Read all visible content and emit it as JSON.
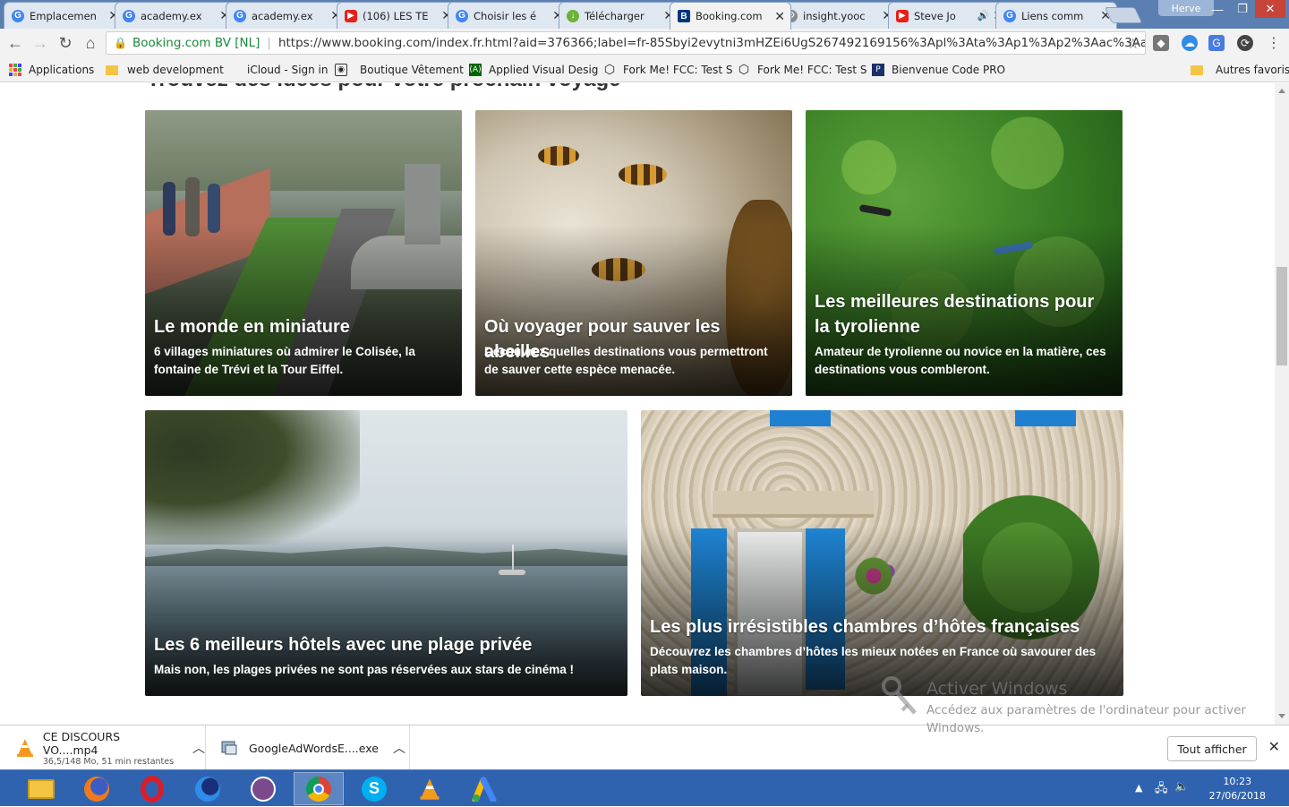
{
  "browser": {
    "tabs": [
      {
        "title": "Emplacemen",
        "icon": "google-icon",
        "color": "#4285f4",
        "letter": "G"
      },
      {
        "title": "academy.ex",
        "icon": "google-icon",
        "color": "#4285f4",
        "letter": "G"
      },
      {
        "title": "academy.ex",
        "icon": "google-icon",
        "color": "#4285f4",
        "letter": "G"
      },
      {
        "title": "(106) LES TE",
        "icon": "youtube-icon",
        "color": "#e62117",
        "letter": "▶"
      },
      {
        "title": "Choisir les é",
        "icon": "google-icon",
        "color": "#4285f4",
        "letter": "G"
      },
      {
        "title": "Télécharger",
        "icon": "download-icon",
        "color": "#6bb23b",
        "letter": "↓"
      },
      {
        "title": "Booking.com",
        "icon": "booking-icon",
        "color": "#003580",
        "letter": "B"
      },
      {
        "title": "insight.yooc",
        "icon": "gear-icon",
        "color": "#888888",
        "letter": "⚙"
      },
      {
        "title": "Steve Jo",
        "icon": "youtube-icon",
        "color": "#e62117",
        "letter": "▶"
      },
      {
        "title": "Liens comm",
        "icon": "google-icon",
        "color": "#4285f4",
        "letter": "G"
      }
    ],
    "audio_icon": "🔊",
    "user": "Herve",
    "secure_label": "Booking.com BV [NL]",
    "url": "https://www.booking.com/index.fr.html?aid=376366;label=fr-85Sbyi2evytni3mHZEi6UgS267492169156%3Apl%3Ata%3Ap1%3Ap2%3Aac%3Aap1t1%3A...",
    "bookmarks": [
      {
        "label": "Applications",
        "icon": "apps-icon"
      },
      {
        "label": "web development",
        "icon": "folder-icon"
      },
      {
        "label": "iCloud - Sign in",
        "icon": "apple-icon"
      },
      {
        "label": "Boutique Vêtement",
        "icon": "shop-icon"
      },
      {
        "label": "Applied Visual Desig",
        "icon": "fcc-icon"
      },
      {
        "label": "Fork Me! FCC: Test S",
        "icon": "codepen-icon"
      },
      {
        "label": "Fork Me! FCC: Test S",
        "icon": "codepen-icon"
      },
      {
        "label": "Bienvenue Code PRO",
        "icon": "codepro-icon"
      }
    ],
    "other_bookmarks": "Autres favoris"
  },
  "page": {
    "heading": "Trouvez des idées pour votre prochain voyage",
    "cards": [
      {
        "title": "Le monde en miniature",
        "desc": "6 villages miniatures où admirer le Colisée, la fontaine de Trévi et la Tour Eiffel."
      },
      {
        "title": "Où voyager pour sauver les abeilles",
        "desc": "Découvrez quelles destinations vous permettront de sauver cette espèce menacée."
      },
      {
        "title": "Les meilleures destinations pour la tyrolienne",
        "desc": "Amateur de tyrolienne ou novice en la matière, ces destinations vous combleront."
      },
      {
        "title": "Les 6 meilleurs hôtels avec une plage privée",
        "desc": "Mais non, les plages privées ne sont pas réservées aux stars de cinéma !"
      },
      {
        "title": "Les plus irrésistibles chambres d’hôtes françaises",
        "desc": "Découvrez les chambres d’hôtes les mieux notées en France où savourer des plats maison."
      }
    ]
  },
  "watermark": {
    "title": "Activer Windows",
    "subtitle": "Accédez aux paramètres de l'ordinateur pour activer Windows."
  },
  "downloads": {
    "items": [
      {
        "name": "CE DISCOURS VO....mp4",
        "status": "36,5/148 Mo, 51 min restantes",
        "icon": "vlc-icon"
      },
      {
        "name": "GoogleAdWordsE....exe",
        "status": "",
        "icon": "installer-icon"
      }
    ],
    "show_all": "Tout afficher"
  },
  "taskbar": {
    "apps": [
      "file-explorer-icon",
      "firefox-icon",
      "opera-icon",
      "firefox-dev-icon",
      "tor-icon",
      "chrome-icon",
      "skype-icon",
      "vlc-icon",
      "adwords-icon"
    ],
    "time": "10:23",
    "date": "27/06/2018"
  }
}
